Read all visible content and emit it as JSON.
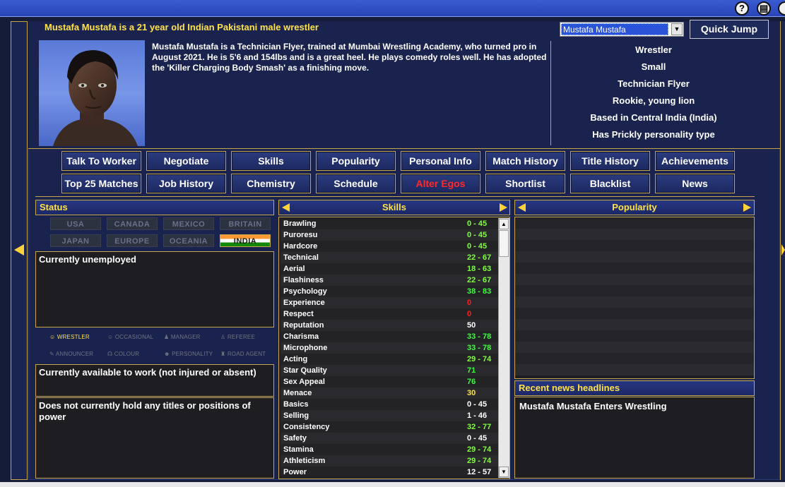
{
  "toolbar": {
    "help_icon_glyph": "?",
    "save_icon_glyph": "▤",
    "close_icon_glyph": "⏻"
  },
  "header": {
    "title": "Mustafa Mustafa is a 21 year old Indian Pakistani male wrestler",
    "bio": "Mustafa Mustafa is a Technician Flyer, trained at Mumbai Wrestling Academy, who turned pro in August 2021. He is 5'6 and 154lbs and is a great heel. He plays comedy roles well. He has adopted the 'Killer Charging Body Smash' as a finishing move.",
    "select_value": "Mustafa Mustafa",
    "quick_jump_label": "Quick Jump",
    "attributes": [
      "Wrestler",
      "Small",
      "Technician Flyer",
      "Rookie, young lion",
      "Based in Central India (India)",
      "Has Prickly personality type"
    ]
  },
  "nav": {
    "row1": [
      "Talk To Worker",
      "Negotiate",
      "Skills",
      "Popularity",
      "Personal Info",
      "Match History",
      "Title History",
      "Achievements"
    ],
    "row2": [
      "Top 25 Matches",
      "Job History",
      "Chemistry",
      "Schedule",
      "Alter Egos",
      "Shortlist",
      "Blacklist",
      "News"
    ]
  },
  "status": {
    "title": "Status",
    "regions": [
      "USA",
      "CANADA",
      "MEXICO",
      "BRITAIN",
      "JAPAN",
      "EUROPE",
      "OCEANIA",
      "INDIA"
    ],
    "active_region": "INDIA",
    "employment": "Currently unemployed",
    "roles": [
      "WRESTLER",
      "OCCASIONAL",
      "MANAGER",
      "REFEREE",
      "ANNOUNCER",
      "COLOUR",
      "PERSONALITY",
      "ROAD AGENT"
    ],
    "active_role": "WRESTLER",
    "availability": "Currently available to work (not injured or absent)",
    "titles": "Does not currently hold any titles or positions of power"
  },
  "skills": {
    "title": "Skills",
    "rows": [
      {
        "name": "Brawling",
        "value": "0 - 45",
        "color": "#7fff3a"
      },
      {
        "name": "Puroresu",
        "value": "0 - 45",
        "color": "#7fff3a"
      },
      {
        "name": "Hardcore",
        "value": "0 - 45",
        "color": "#7fff3a"
      },
      {
        "name": "Technical",
        "value": "22 - 67",
        "color": "#7fff3a"
      },
      {
        "name": "Aerial",
        "value": "18 - 63",
        "color": "#7fff3a"
      },
      {
        "name": "Flashiness",
        "value": "22 - 67",
        "color": "#7fff3a"
      },
      {
        "name": "Psychology",
        "value": "38 - 83",
        "color": "#3aff3a"
      },
      {
        "name": "Experience",
        "value": "0",
        "color": "#ff2020"
      },
      {
        "name": "Respect",
        "value": "0",
        "color": "#ff2020"
      },
      {
        "name": "Reputation",
        "value": "50",
        "color": "#ffffff"
      },
      {
        "name": "Charisma",
        "value": "33 - 78",
        "color": "#3aff3a"
      },
      {
        "name": "Microphone",
        "value": "33 - 78",
        "color": "#3aff3a"
      },
      {
        "name": "Acting",
        "value": "29 - 74",
        "color": "#7fff3a"
      },
      {
        "name": "Star Quality",
        "value": "71",
        "color": "#3aff3a"
      },
      {
        "name": "Sex Appeal",
        "value": "76",
        "color": "#3aff3a"
      },
      {
        "name": "Menace",
        "value": "30",
        "color": "#ffe14a"
      },
      {
        "name": "Basics",
        "value": "0 - 45",
        "color": "#ffffff"
      },
      {
        "name": "Selling",
        "value": "1 - 46",
        "color": "#ffffff"
      },
      {
        "name": "Consistency",
        "value": "32 - 77",
        "color": "#7fff3a"
      },
      {
        "name": "Safety",
        "value": "0 - 45",
        "color": "#ffffff"
      },
      {
        "name": "Stamina",
        "value": "29 - 74",
        "color": "#7fff3a"
      },
      {
        "name": "Athleticism",
        "value": "29 - 74",
        "color": "#7fff3a"
      },
      {
        "name": "Power",
        "value": "12 - 57",
        "color": "#ffffff"
      }
    ]
  },
  "popularity": {
    "title": "Popularity"
  },
  "news": {
    "title": "Recent news headlines",
    "headline": "Mustafa Mustafa Enters Wrestling"
  }
}
